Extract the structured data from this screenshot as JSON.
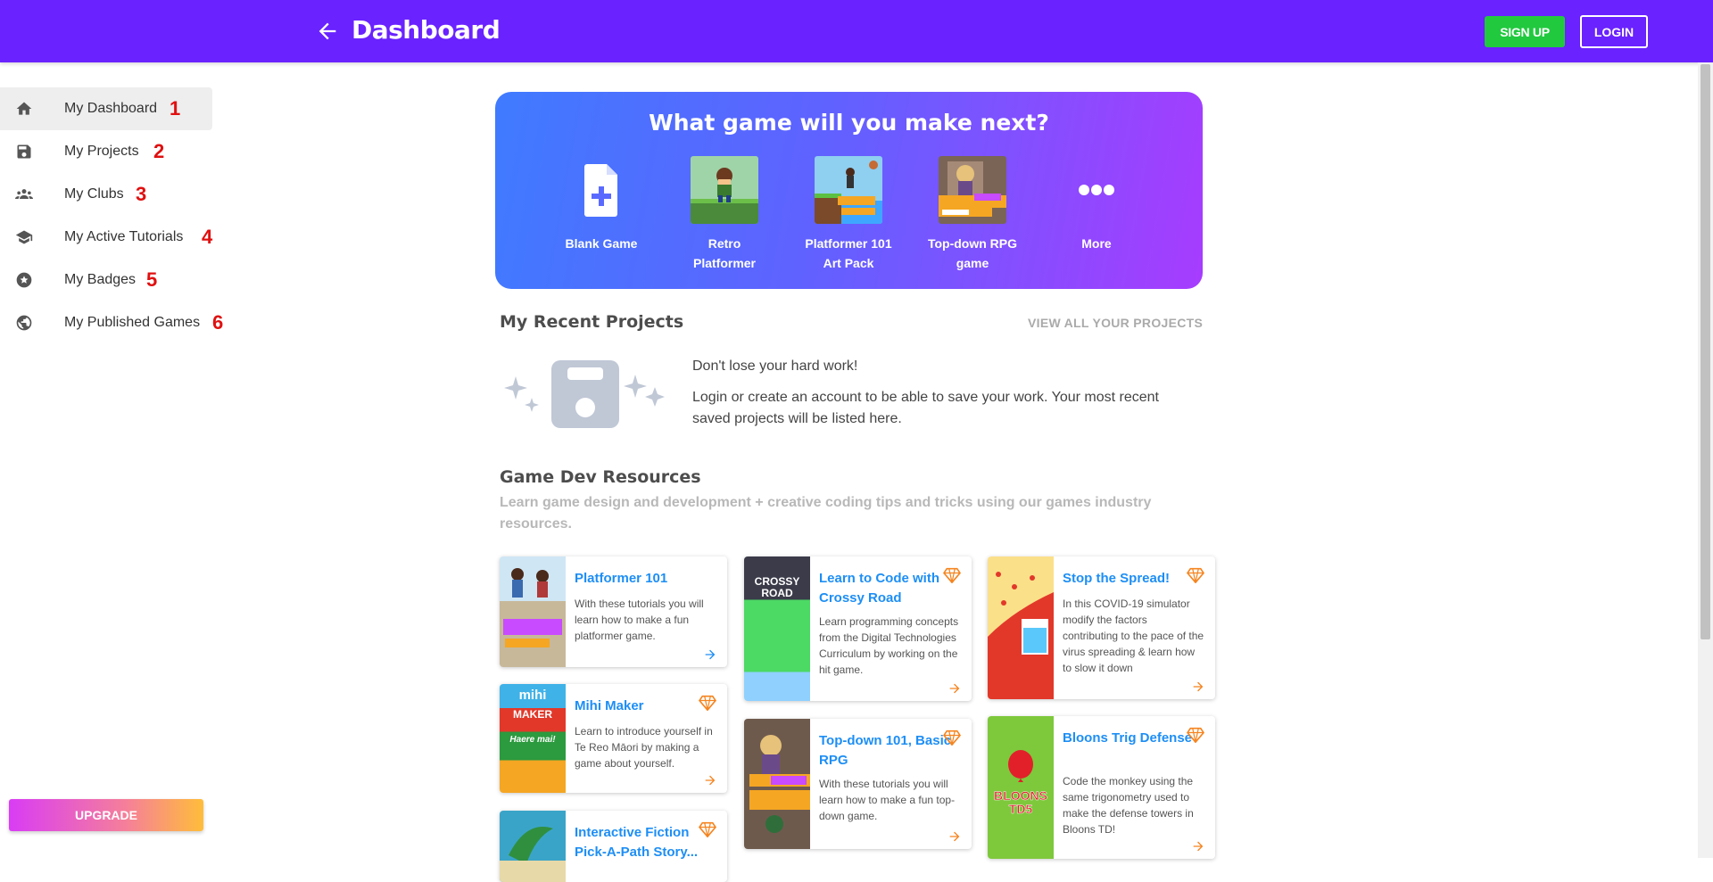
{
  "header": {
    "title": "Dashboard",
    "signup_label": "SIGN UP",
    "login_label": "LOGIN"
  },
  "sidebar": {
    "items": [
      {
        "label": "My Dashboard",
        "icon": "home-icon",
        "num": "1"
      },
      {
        "label": "My Projects",
        "icon": "save-icon",
        "num": "2"
      },
      {
        "label": "My Clubs",
        "icon": "group-icon",
        "num": "3"
      },
      {
        "label": "My Active Tutorials",
        "icon": "school-icon",
        "num": "4"
      },
      {
        "label": "My Badges",
        "icon": "badge-star-icon",
        "num": "5"
      },
      {
        "label": "My Published Games",
        "icon": "globe-icon",
        "num": "6"
      }
    ],
    "upgrade_label": "UPGRADE"
  },
  "hero": {
    "title": "What game will you make next?",
    "templates": [
      {
        "label": "Blank Game"
      },
      {
        "label": "Retro Platformer"
      },
      {
        "label": "Platformer 101 Art Pack"
      },
      {
        "label": "Top-down RPG game"
      },
      {
        "label": "More"
      }
    ]
  },
  "recent": {
    "title": "My Recent Projects",
    "view_all": "VIEW ALL YOUR PROJECTS",
    "msg_title": "Don't lose your hard work!",
    "msg_body": "Login or create an account to be able to save your work. Your most recent saved projects will be listed here."
  },
  "resources": {
    "title": "Game Dev Resources",
    "subtitle": "Learn game design and development + creative coding tips and tricks using our games industry resources.",
    "cards": [
      {
        "title": "Platformer 101",
        "desc": "With these tutorials you will learn how to make a fun platformer game."
      },
      {
        "title": "Mihi Maker",
        "desc": "Learn to introduce yourself in Te Reo Māori by making a game about yourself."
      },
      {
        "title": "Interactive Fiction Pick-A-Path Story...",
        "desc": ""
      },
      {
        "title": "Learn to Code with Crossy Road",
        "desc": "Learn programming concepts from the Digital Technologies Curriculum by working on the hit game."
      },
      {
        "title": "Top-down 101, Basic RPG",
        "desc": "With these tutorials you will learn how to make a fun top-down game."
      },
      {
        "title": "Stop the Spread!",
        "desc": "In this COVID-19 simulator modify the factors contributing to the pace of the virus spreading & learn how to slow it down"
      },
      {
        "title": "Bloons Trig Defense",
        "desc": "Code the monkey using the same trigonometry used to make the defense towers in Bloons TD!"
      }
    ],
    "thumb_text": {
      "crossy": "CROSSY ROAD",
      "mihi_1": "mihi",
      "mihi_2": "MAKER",
      "mihi_3": "Haere mai!",
      "bloons": "BLOONS TD5"
    }
  },
  "colors": {
    "header": "#6a22ff",
    "signup": "#21c93f",
    "link": "#1d8ef5",
    "premium": "#f5841f",
    "number": "#e01010"
  }
}
